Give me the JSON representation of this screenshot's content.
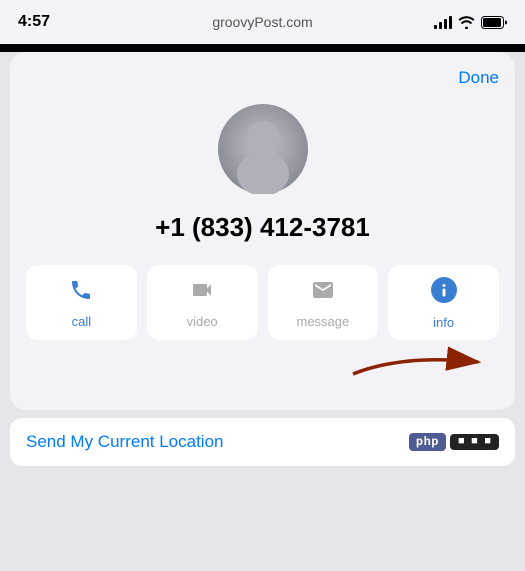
{
  "statusBar": {
    "time": "4:57",
    "site": "groovyPost.com"
  },
  "header": {
    "done_label": "Done"
  },
  "contact": {
    "phone_number": "+1 (833) 412-3781"
  },
  "actions": [
    {
      "id": "call",
      "label": "call",
      "enabled": true,
      "icon": "phone"
    },
    {
      "id": "video",
      "label": "video",
      "enabled": false,
      "icon": "video"
    },
    {
      "id": "msg",
      "label": "message",
      "enabled": false,
      "icon": "message"
    },
    {
      "id": "info",
      "label": "info",
      "enabled": true,
      "icon": "info"
    }
  ],
  "locationCard": {
    "label": "Send My Current Location"
  }
}
